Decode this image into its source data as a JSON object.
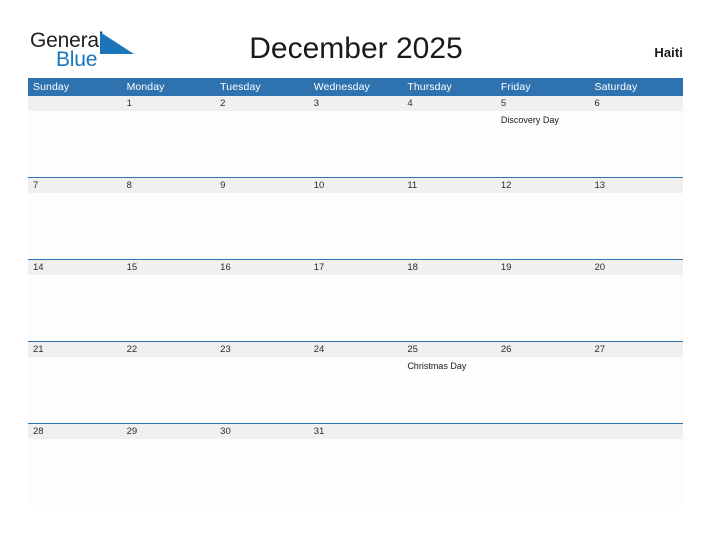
{
  "brand": {
    "name_part1": "General",
    "name_part2": "Blue",
    "flag_icon": "blue-triangle-flag"
  },
  "header": {
    "title": "December 2025",
    "region": "Haiti"
  },
  "colors": {
    "header_blue": "#2f72b0",
    "date_band_gray": "#f0f0f0",
    "brand_blue": "#1b75bb",
    "text_dark": "#1a1a1a"
  },
  "calendar": {
    "month": "December",
    "year": "2025",
    "weekday_headers": [
      "Sunday",
      "Monday",
      "Tuesday",
      "Wednesday",
      "Thursday",
      "Friday",
      "Saturday"
    ],
    "weeks": [
      {
        "days": [
          {
            "date": "",
            "events": []
          },
          {
            "date": "1",
            "events": []
          },
          {
            "date": "2",
            "events": []
          },
          {
            "date": "3",
            "events": []
          },
          {
            "date": "4",
            "events": []
          },
          {
            "date": "5",
            "events": [
              "Discovery Day"
            ]
          },
          {
            "date": "6",
            "events": []
          }
        ]
      },
      {
        "days": [
          {
            "date": "7",
            "events": []
          },
          {
            "date": "8",
            "events": []
          },
          {
            "date": "9",
            "events": []
          },
          {
            "date": "10",
            "events": []
          },
          {
            "date": "11",
            "events": []
          },
          {
            "date": "12",
            "events": []
          },
          {
            "date": "13",
            "events": []
          }
        ]
      },
      {
        "days": [
          {
            "date": "14",
            "events": []
          },
          {
            "date": "15",
            "events": []
          },
          {
            "date": "16",
            "events": []
          },
          {
            "date": "17",
            "events": []
          },
          {
            "date": "18",
            "events": []
          },
          {
            "date": "19",
            "events": []
          },
          {
            "date": "20",
            "events": []
          }
        ]
      },
      {
        "days": [
          {
            "date": "21",
            "events": []
          },
          {
            "date": "22",
            "events": []
          },
          {
            "date": "23",
            "events": []
          },
          {
            "date": "24",
            "events": []
          },
          {
            "date": "25",
            "events": [
              "Christmas Day"
            ]
          },
          {
            "date": "26",
            "events": []
          },
          {
            "date": "27",
            "events": []
          }
        ]
      },
      {
        "days": [
          {
            "date": "28",
            "events": []
          },
          {
            "date": "29",
            "events": []
          },
          {
            "date": "30",
            "events": []
          },
          {
            "date": "31",
            "events": []
          },
          {
            "date": "",
            "events": []
          },
          {
            "date": "",
            "events": []
          },
          {
            "date": "",
            "events": []
          }
        ]
      }
    ]
  }
}
